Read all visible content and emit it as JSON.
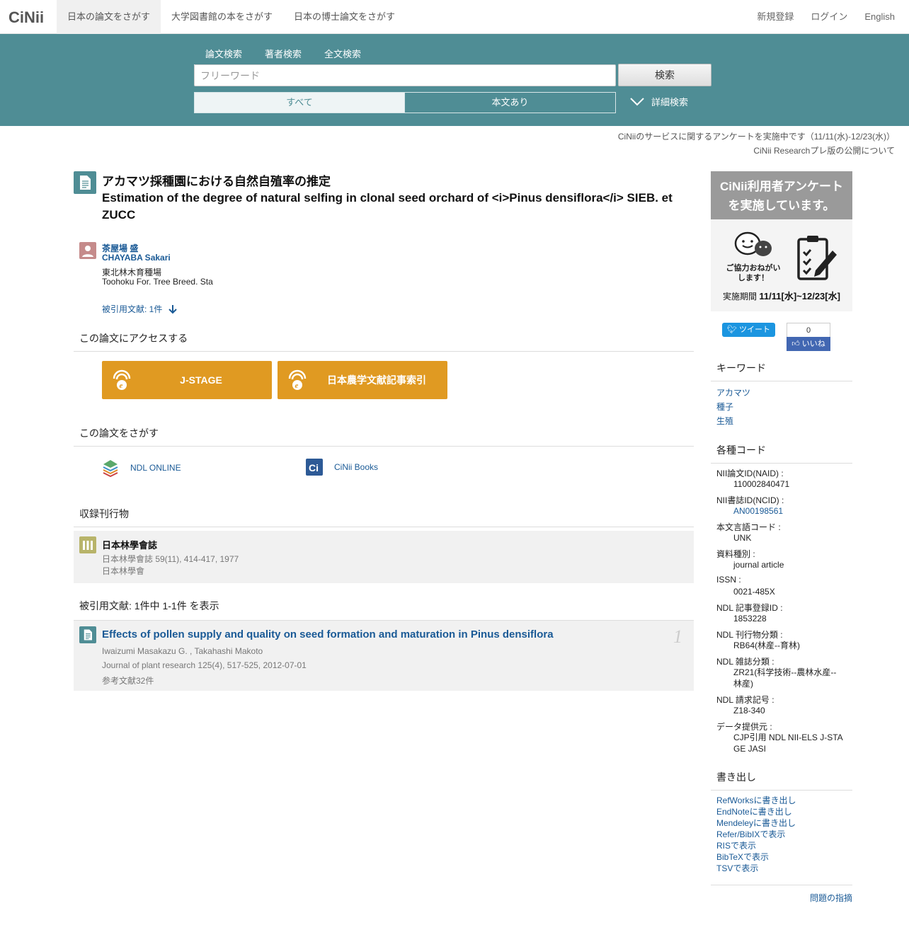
{
  "brand": {
    "logo": "CiNii",
    "accent": "#4f8d95",
    "link_color": "#1a5a96",
    "button_color": "#e09a22"
  },
  "topnav": {
    "tabs": [
      "日本の論文をさがす",
      "大学図書館の本をさがす",
      "日本の博士論文をさがす"
    ],
    "right": [
      "新規登録",
      "ログイン",
      "English"
    ]
  },
  "search": {
    "tabs": [
      "論文検索",
      "著者検索",
      "全文検索"
    ],
    "placeholder": "フリーワード",
    "button": "検索",
    "seg_all": "すべて",
    "seg_full": "本文あり",
    "advanced": "詳細検索"
  },
  "notices": [
    "CiNiiのサービスに関するアンケートを実施中です（11/11(水)-12/23(水)）",
    "CiNii Researchプレ版の公開について"
  ],
  "article": {
    "title_ja": "アカマツ採種園における自然自殖率の推定",
    "title_en": "Estimation of the degree of natural selfing in clonal seed orchard of <i>Pinus densiflora</i> SIEB. et ZUCC",
    "author_ja": "茶屋場 盛",
    "author_en": "CHAYABA Sakari",
    "affil_ja": "東北林木育種場",
    "affil_en": "Toohoku For. Tree Breed. Sta",
    "cited_count": "被引用文献: 1件"
  },
  "access": {
    "heading": "この論文にアクセスする",
    "buttons": [
      "J-STAGE",
      "日本農学文献記事索引"
    ]
  },
  "find": {
    "heading": "この論文をさがす",
    "links": [
      "NDL ONLINE",
      "CiNii Books"
    ]
  },
  "journal": {
    "heading": "収録刊行物",
    "title": "日本林學會誌",
    "detail": "日本林學會誌 59(11), 414-417, 1977",
    "publisher": "日本林學會"
  },
  "cited": {
    "heading": "被引用文献:  1件中 1-1件 を表示",
    "items": [
      {
        "title": "Effects of pollen supply and quality on seed formation and maturation in Pinus densiflora",
        "authors": "Iwaizumi Masakazu G. , Takahashi Makoto",
        "journal": "Journal of plant research 125(4), 517-525, 2012-07-01",
        "refs": "参考文献32件",
        "number": "1"
      }
    ]
  },
  "sidebar": {
    "banner_line1": "CiNii利用者アンケート",
    "banner_line2": "を実施しています。",
    "banner_coop": "ご協力おねがいします！",
    "banner_period_label": "実施期間",
    "banner_period": "11/11[水]~12/23[水]",
    "tweet": "ツイート",
    "like_count": "0",
    "like": "いいね",
    "keywords_heading": "キーワード",
    "keywords": [
      "アカマツ",
      "種子",
      "生殖"
    ],
    "codes_heading": "各種コード",
    "codes": [
      {
        "label": "NII論文ID(NAID) :",
        "value": "110002840471"
      },
      {
        "label": "NII書誌ID(NCID) :",
        "value": "AN00198561"
      },
      {
        "label": "本文言語コード :",
        "value": "UNK"
      },
      {
        "label": "資料種別 :",
        "value": "journal article"
      },
      {
        "label": "ISSN :",
        "value": "0021-485X"
      },
      {
        "label": "NDL 記事登録ID :",
        "value": "1853228"
      },
      {
        "label": "NDL 刊行物分類 :",
        "value": "RB64(林産--育林)"
      },
      {
        "label": "NDL 雑誌分類 :",
        "value": "ZR21(科学技術--農林水産--林産)"
      },
      {
        "label": "NDL 請求記号 :",
        "value": "Z18-340"
      },
      {
        "label": "データ提供元 :",
        "value": "CJP引用  NDL  NII-ELS  J-STAGE  JASI"
      }
    ],
    "export_heading": "書き出し",
    "exports": [
      "RefWorksに書き出し",
      "EndNoteに書き出し",
      "Mendeleyに書き出し",
      "Refer/BibIXで表示",
      "RISで表示",
      "BibTeXで表示",
      "TSVで表示"
    ],
    "report": "問題の指摘"
  }
}
